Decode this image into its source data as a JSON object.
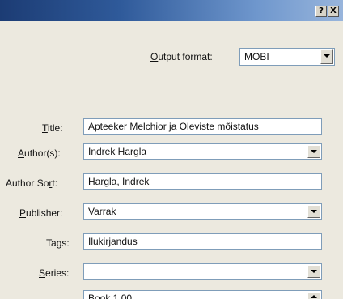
{
  "window": {
    "help_glyph": "?",
    "close_glyph": "X"
  },
  "output": {
    "label_pre": "",
    "label_ul": "O",
    "label_post": "utput format:",
    "value": "MOBI"
  },
  "fields": {
    "title": {
      "label_pre": "",
      "label_ul": "T",
      "label_post": "itle:",
      "value": "Apteeker Melchior ja Oleviste mõistatus"
    },
    "authors": {
      "label_pre": "",
      "label_ul": "A",
      "label_post": "uthor(s):",
      "value": "Indrek Hargla"
    },
    "author_sort": {
      "label_pre": "Author So",
      "label_ul": "r",
      "label_post": "t:",
      "value": "Hargla, Indrek"
    },
    "publisher": {
      "label_pre": "",
      "label_ul": "P",
      "label_post": "ublisher:",
      "value": "Varrak"
    },
    "tags": {
      "label_pre": "Ta",
      "label_ul": "g",
      "label_post": "s:",
      "value": "Ilukirjandus"
    },
    "series": {
      "label_pre": "",
      "label_ul": "S",
      "label_post": "eries:",
      "value": ""
    },
    "series_index": {
      "value": "Book 1.00"
    }
  }
}
